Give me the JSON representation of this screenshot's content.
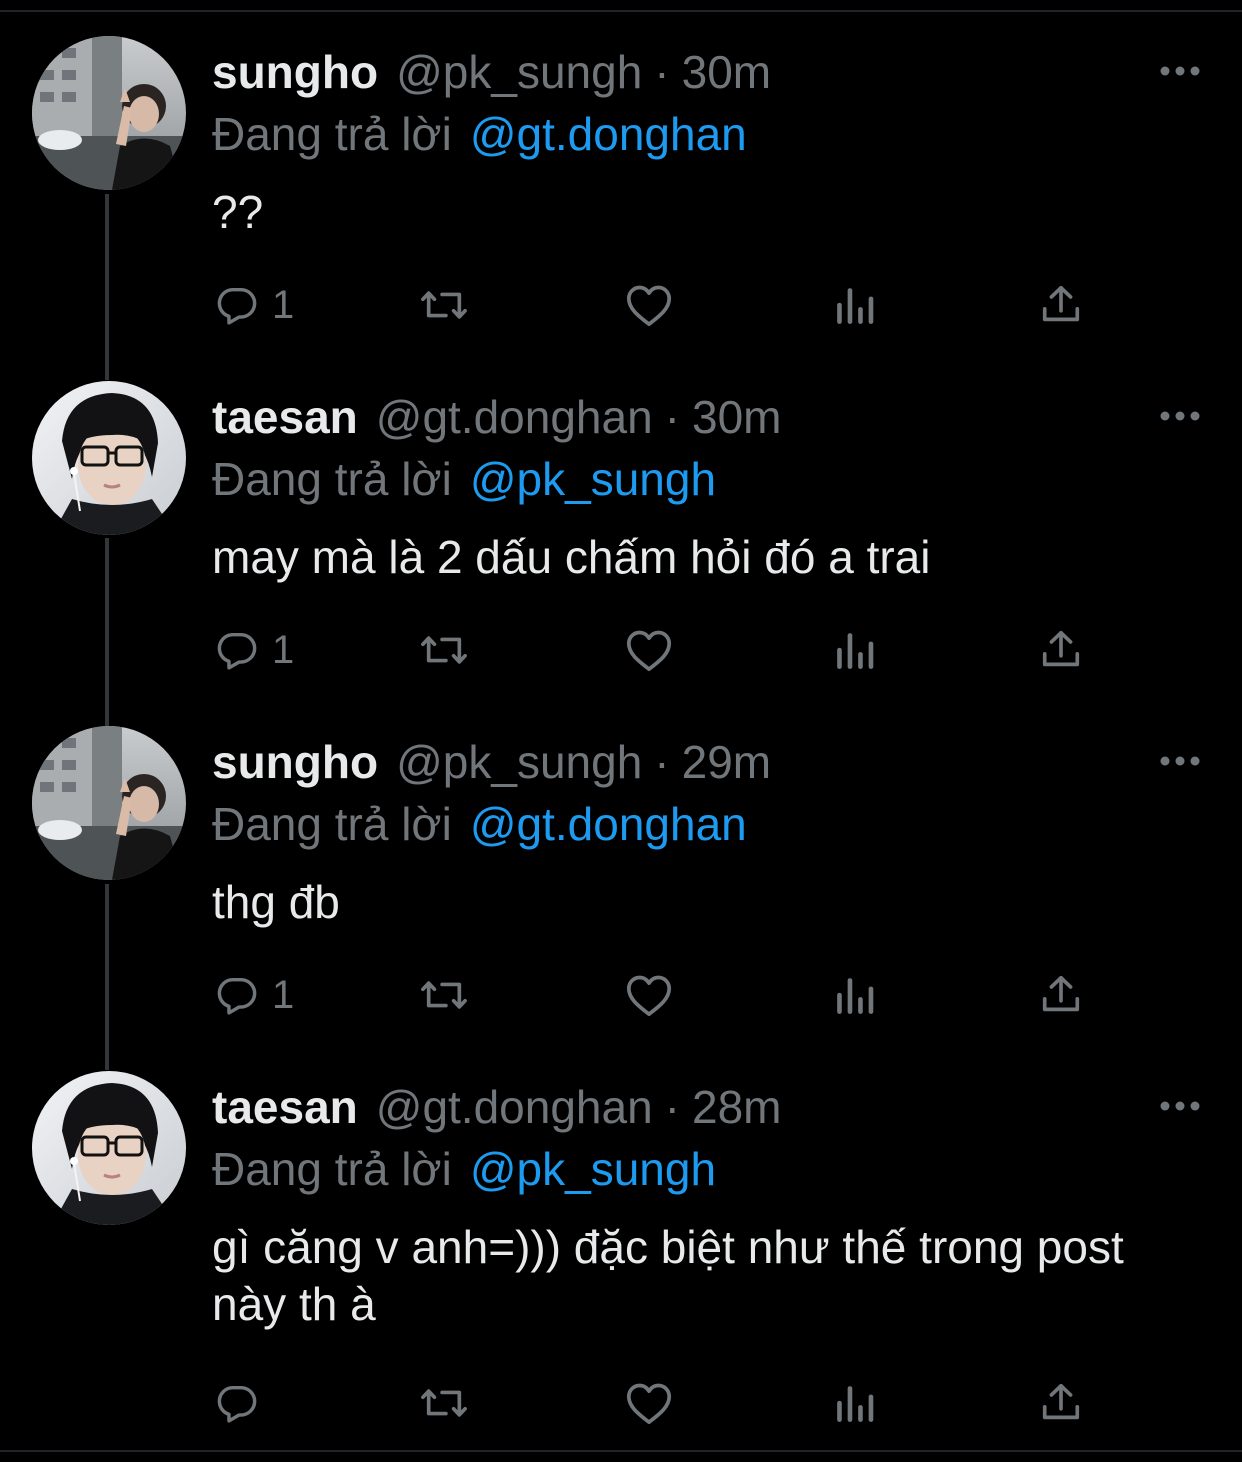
{
  "thread": [
    {
      "display_name": "sungho",
      "handle": "@pk_sungh",
      "separator": "·",
      "time": "30m",
      "reply_prefix": "Đang trả lời",
      "reply_to": "@gt.donghan",
      "text": "??",
      "reply_count": "1",
      "avatar": "sungho-avatar"
    },
    {
      "display_name": "taesan",
      "handle": "@gt.donghan",
      "separator": "·",
      "time": "30m",
      "reply_prefix": "Đang trả lời",
      "reply_to": "@pk_sungh",
      "text": "may mà là 2 dấu chấm hỏi đó a trai",
      "reply_count": "1",
      "avatar": "taesan-avatar"
    },
    {
      "display_name": "sungho",
      "handle": "@pk_sungh",
      "separator": "·",
      "time": "29m",
      "reply_prefix": "Đang trả lời",
      "reply_to": "@gt.donghan",
      "text": "thg đb",
      "reply_count": "1",
      "avatar": "sungho-avatar"
    },
    {
      "display_name": "taesan",
      "handle": "@gt.donghan",
      "separator": "·",
      "time": "28m",
      "reply_prefix": "Đang trả lời",
      "reply_to": "@pk_sungh",
      "text": "gì căng v anh=))) đặc biệt như thế trong post này th à",
      "reply_count": "",
      "avatar": "taesan-avatar"
    }
  ],
  "icons": {
    "more": "more-dots-icon",
    "reply": "reply-bubble-icon",
    "retweet": "retweet-icon",
    "like": "heart-icon",
    "views": "views-bar-chart-icon",
    "share": "share-upload-icon"
  },
  "colors": {
    "background": "#000000",
    "primary_text": "#e7e9ea",
    "secondary_text": "#71767b",
    "link": "#1d9bf0",
    "thread_line": "#333639"
  }
}
